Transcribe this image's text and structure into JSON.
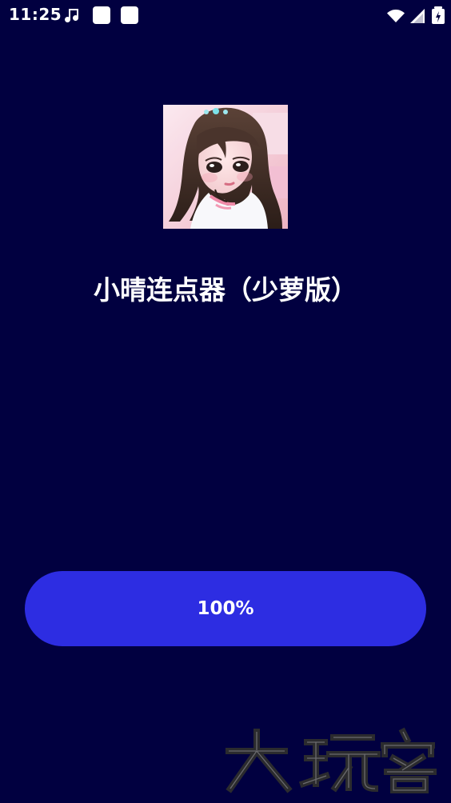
{
  "status_bar": {
    "time": "11:25",
    "left_icons": [
      "music-note-icon",
      "square-notification-icon",
      "square-notification-icon"
    ],
    "right_icons": [
      "wifi-icon",
      "signal-icon",
      "battery-icon"
    ]
  },
  "app": {
    "avatar_icon": "anime-girl-avatar-icon",
    "title": "小晴连点器（少萝版）"
  },
  "loading": {
    "progress_text": "100%",
    "progress": 1.0
  },
  "watermark": {
    "text": "大玩客"
  },
  "colors": {
    "background": "#010040",
    "button": "#2d2de2",
    "text": "#ffffff"
  }
}
